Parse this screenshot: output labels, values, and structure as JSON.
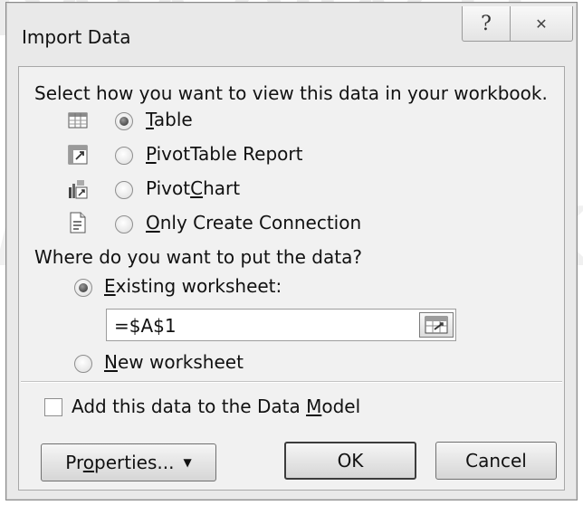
{
  "dialog": {
    "title": "Import Data",
    "help_glyph": "?",
    "close_glyph": "✕"
  },
  "view": {
    "prompt": "Select how you want to view this data in your workbook.",
    "options": [
      {
        "pre": "",
        "key": "T",
        "post": "able",
        "icon": "table-icon",
        "checked": true
      },
      {
        "pre": "",
        "key": "P",
        "post": "ivotTable Report",
        "icon": "pivottable-icon",
        "checked": false
      },
      {
        "pre": "Pivot",
        "key": "C",
        "post": "hart",
        "icon": "pivotchart-icon",
        "checked": false
      },
      {
        "pre": "",
        "key": "O",
        "post": "nly Create Connection",
        "icon": "connection-icon",
        "checked": false
      }
    ]
  },
  "location": {
    "prompt": "Where do you want to put the data?",
    "existing": {
      "pre": "",
      "key": "E",
      "post": "xisting worksheet:",
      "checked": true
    },
    "reference_value": "=$A$1",
    "new": {
      "pre": "",
      "key": "N",
      "post": "ew worksheet",
      "checked": false
    }
  },
  "data_model": {
    "pre": "Add this data to the Data ",
    "key": "M",
    "post": "odel",
    "checked": false
  },
  "buttons": {
    "properties": {
      "pre": "Pr",
      "key": "o",
      "post": "perties..."
    },
    "ok": "OK",
    "cancel": "Cancel"
  }
}
